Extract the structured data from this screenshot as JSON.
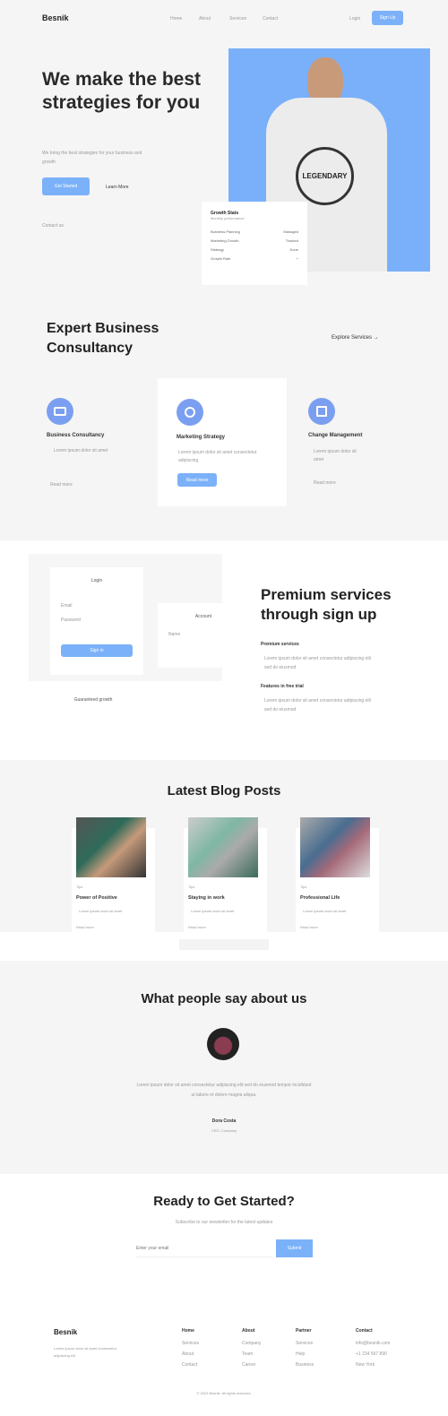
{
  "nav": {
    "logo": "Besnik",
    "links": [
      "Home",
      "About",
      "Services",
      "Contact"
    ],
    "login": "Login",
    "signup": "Sign Up"
  },
  "hero": {
    "title": "We make the best strategies for you",
    "subtitle": "We bring the best strategies for your business and growth",
    "primary": "Get Started",
    "secondary": "Learn More",
    "contact": "Contact us",
    "card": {
      "title": "Growth Stats",
      "subtitle": "Monthly performance",
      "rows": [
        [
          "Business Planning",
          "Managed"
        ],
        [
          "Marketing Growth",
          "Tracked"
        ],
        [
          "Strategy",
          "Done"
        ],
        [
          "Growth Rate",
          "+"
        ]
      ]
    }
  },
  "consult": {
    "title": "Expert Business Consultancy",
    "explore": "Explore Services",
    "arrow": "→",
    "cards": [
      {
        "title": "Business Consultancy",
        "text": "Lorem ipsum dolor sit amet",
        "link": "Read more"
      },
      {
        "title": "Marketing Strategy",
        "text": "Lorem ipsum dolor sit amet consectetur adipiscing",
        "link": "Read more"
      },
      {
        "title": "Change Management",
        "text": "Lorem ipsum dolor sit amet",
        "link": "Read more"
      }
    ]
  },
  "premium": {
    "title": "Premium services through sign up",
    "login": "Login",
    "login_btn": "Sign in",
    "field1": "Email",
    "field2": "Password",
    "account": "Account",
    "field3": "Name",
    "growth": "Guaranteed growth",
    "items": [
      {
        "title": "Premium services",
        "text": "Lorem ipsum dolor sit amet consectetur adipiscing elit sed do eiusmod"
      },
      {
        "title": "Features in free trial",
        "text": "Lorem ipsum dolor sit amet consectetur adipiscing elit sed do eiusmod"
      }
    ]
  },
  "blog": {
    "title": "Latest Blog Posts",
    "posts": [
      {
        "tag": "Tips",
        "title": "Power of Positive",
        "text": "Lorem ipsum dolor sit amet",
        "link": "Read more"
      },
      {
        "tag": "Tips",
        "title": "Staying in work",
        "text": "Lorem ipsum dolor sit amet",
        "link": "Read more"
      },
      {
        "tag": "Tips",
        "title": "Professional Life",
        "text": "Lorem ipsum dolor sit amet",
        "link": "Read more"
      }
    ]
  },
  "testimonial": {
    "title": "What people say about us",
    "quote": "Lorem ipsum dolor sit amet consectetur adipiscing elit sed do eiusmod tempor incididunt ut labore et dolore magna aliqua.",
    "name": "Dora Costa",
    "role": "CEO, Company"
  },
  "cta": {
    "title": "Ready to Get Started?",
    "subtitle": "Subscribe to our newsletter for the latest updates",
    "placeholder": "Enter your email",
    "button": "Submit"
  },
  "footer": {
    "logo": "Besnik",
    "text": "Lorem ipsum dolor sit amet consectetur adipiscing elit",
    "columns": [
      [
        "Home",
        "Services",
        "About",
        "Contact"
      ],
      [
        "About",
        "Company",
        "Team",
        "Career"
      ],
      [
        "Partner",
        "Services",
        "Help",
        "Business"
      ],
      [
        "Contact",
        "info@besnik.com",
        "+1 234 567 890",
        "New York"
      ]
    ],
    "copyright": "© 2023 Besnik. All rights reserved."
  },
  "colors": {
    "accent": "#7bb1f8",
    "hero_image_bg": "#7ab0fa",
    "section_bg": "#f5f5f5"
  }
}
